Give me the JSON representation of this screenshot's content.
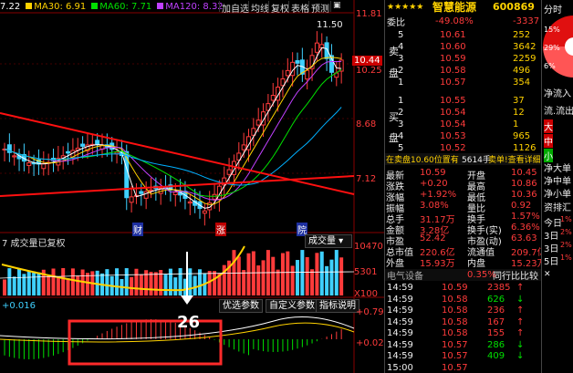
{
  "indicator_bar": {
    "items": [
      {
        "text": "7.22",
        "color": "#ffffff"
      },
      {
        "text": "MA30: 6.91",
        "color": "#ffd200"
      },
      {
        "text": "MA60: 7.71",
        "color": "#00e000"
      },
      {
        "text": "MA120: 8.32",
        "color": "#c040ff"
      }
    ]
  },
  "toolbar": {
    "add_watch": "加自选",
    "avg_line": "均线",
    "restore": "复权",
    "table": "表格",
    "forecast": "预测"
  },
  "price_axis": {
    "top": "11.81",
    "high_mark": "11.50",
    "current": "10.44",
    "mid1": "10.25",
    "mid2": "8.68",
    "low": "7.12"
  },
  "event_markers": [
    "财",
    "涨",
    "院"
  ],
  "volume_panel": {
    "title": "7  成交量已复权",
    "dropdown": "成交量",
    "axis": [
      "10470",
      "5301",
      "X100"
    ]
  },
  "sub_panel": {
    "value": "+0.016",
    "buttons": [
      "优选参数",
      "自定义参数",
      "指标说明"
    ],
    "axis": [
      "+0.795",
      "+0.027"
    ]
  },
  "annotation": {
    "number": "26"
  },
  "quote": {
    "name": "智慧能源",
    "code": "600869",
    "stars": "★★★★★",
    "weibi_label": "委比",
    "weibi": "-49.08%",
    "weicha": "-3337",
    "sell": [
      {
        "lvl": "5",
        "price": "10.61",
        "vol": "252"
      },
      {
        "lvl": "4",
        "price": "10.60",
        "vol": "3642"
      },
      {
        "lvl": "3",
        "price": "10.59",
        "vol": "2259"
      },
      {
        "lvl": "2",
        "price": "10.58",
        "vol": "496"
      },
      {
        "lvl": "1",
        "price": "10.57",
        "vol": "354"
      }
    ],
    "buy": [
      {
        "lvl": "1",
        "price": "10.55",
        "vol": "37"
      },
      {
        "lvl": "2",
        "price": "10.54",
        "vol": "12"
      },
      {
        "lvl": "3",
        "price": "10.54",
        "vol": "1"
      },
      {
        "lvl": "4",
        "price": "10.53",
        "vol": "965"
      },
      {
        "lvl": "5",
        "price": "10.52",
        "vol": "1126"
      }
    ],
    "sell_side": [
      "卖",
      "盘"
    ],
    "buy_side": [
      "买",
      "盘"
    ],
    "note_left": "在卖盘10.60位置有",
    "note_vol": "5614手",
    "note_right": "卖单!查看详细",
    "stats": [
      [
        "最新",
        "10.59",
        "开盘",
        "10.45"
      ],
      [
        "涨跌",
        "+0.20",
        "最高",
        "10.86"
      ],
      [
        "涨幅",
        "+1.92%",
        "最低",
        "10.36"
      ],
      [
        "振幅",
        "3.08%",
        "量比",
        "0.92"
      ],
      [
        "总手",
        "31.17万",
        "换手",
        "1.57%"
      ],
      [
        "金额",
        "3.28亿",
        "换手(实)",
        "6.36%"
      ],
      [
        "市盈",
        "52.42",
        "市盈(动)",
        "63.63"
      ],
      [
        "总市值",
        "220.6亿",
        "流通值",
        "209.7亿"
      ],
      [
        "外盘",
        "15.93万",
        "内盘",
        "15.23万"
      ]
    ],
    "tabs": {
      "equip": "电气设备",
      "pct": "0.35%",
      "peer": "同行比比较"
    },
    "ticks": [
      {
        "t": "14:59",
        "p": "10.59",
        "v": "2385",
        "d": "up"
      },
      {
        "t": "14:59",
        "p": "10.58",
        "v": "626",
        "d": "down"
      },
      {
        "t": "14:59",
        "p": "10.58",
        "v": "236",
        "d": "up"
      },
      {
        "t": "14:59",
        "p": "10.58",
        "v": "167",
        "d": "up"
      },
      {
        "t": "14:59",
        "p": "10.58",
        "v": "155",
        "d": "up"
      },
      {
        "t": "14:59",
        "p": "10.57",
        "v": "286",
        "d": "down"
      },
      {
        "t": "14:59",
        "p": "10.57",
        "v": "409",
        "d": "down"
      },
      {
        "t": "15:00",
        "p": "10.57",
        "v": "",
        "d": ""
      }
    ]
  },
  "far_right": {
    "title": "分时",
    "pcts": [
      "15%",
      "29%",
      "6%"
    ],
    "labels": [
      "净流入",
      "流.流出",
      "大",
      "中",
      "小",
      "净大单",
      "净中单",
      "净小单",
      "资排汇",
      "今日",
      "3日",
      "3日",
      "5日"
    ],
    "vals": [
      "1%",
      "2%",
      "2%",
      "1%"
    ]
  },
  "colors": {
    "up": "#ff3b3b",
    "down": "#00e000",
    "bg": "#000000",
    "ma5": "#ffffff",
    "ma10": "#ffd200",
    "ma20": "#c040ff",
    "ma30": "#00e000",
    "highlight": "#ff2a2a"
  }
}
